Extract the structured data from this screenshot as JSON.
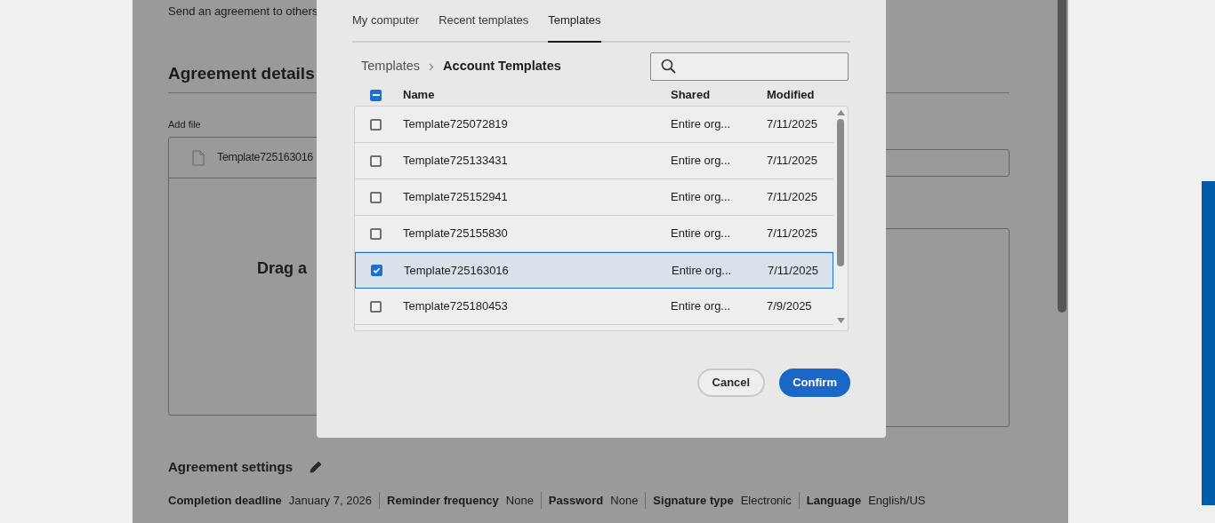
{
  "page": {
    "intro": "Send an agreement to others",
    "section_title": "Agreement details",
    "add_file_label": "Add file",
    "file_name": "Template725163016",
    "drop_hint": "Drag a"
  },
  "settings": {
    "title": "Agreement settings",
    "items": [
      {
        "label": "Completion deadline",
        "value": "January 7, 2026"
      },
      {
        "label": "Reminder frequency",
        "value": "None"
      },
      {
        "label": "Password",
        "value": "None"
      },
      {
        "label": "Signature type",
        "value": "Electronic"
      },
      {
        "label": "Language",
        "value": "English/US"
      }
    ]
  },
  "dialog": {
    "tabs": [
      {
        "label": "My computer",
        "selected": false
      },
      {
        "label": "Recent templates",
        "selected": false
      },
      {
        "label": "Templates",
        "selected": true
      }
    ],
    "breadcrumb": [
      {
        "label": "Templates",
        "current": false
      },
      {
        "label": "Account Templates",
        "current": true
      }
    ],
    "select_all": {
      "mixed": true
    },
    "columns": [
      "Name",
      "Shared",
      "Modified"
    ],
    "rows": [
      {
        "name": "Template725072819",
        "shared": "Entire org...",
        "modified": "7/11/2025",
        "checked": false
      },
      {
        "name": "Template725133431",
        "shared": "Entire org...",
        "modified": "7/11/2025",
        "checked": false
      },
      {
        "name": "Template725152941",
        "shared": "Entire org...",
        "modified": "7/11/2025",
        "checked": false
      },
      {
        "name": "Template725155830",
        "shared": "Entire org...",
        "modified": "7/11/2025",
        "checked": false
      },
      {
        "name": "Template725163016",
        "shared": "Entire org...",
        "modified": "7/11/2025",
        "checked": true
      },
      {
        "name": "Template725180453",
        "shared": "Entire org...",
        "modified": "7/9/2025",
        "checked": false
      }
    ],
    "buttons": [
      {
        "label": "Cancel",
        "kind": "secondary"
      },
      {
        "label": "Confirm",
        "kind": "primary"
      }
    ]
  }
}
